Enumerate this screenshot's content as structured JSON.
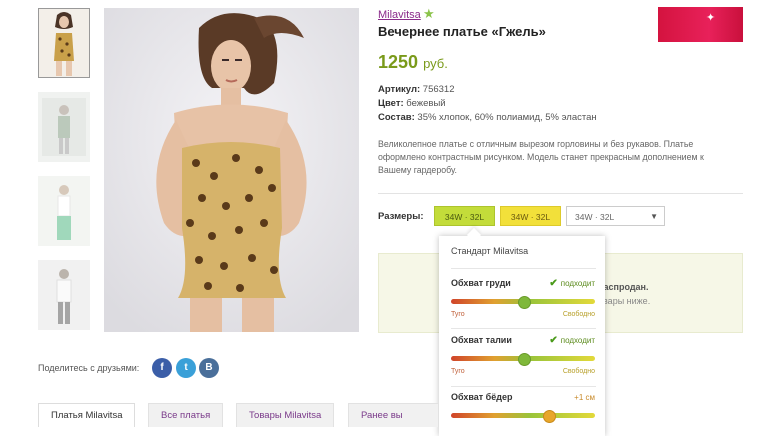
{
  "product": {
    "brand_link": "Milavitsa",
    "title": "Вечернее платье «Гжель»",
    "price_value": "1250",
    "price_currency": "руб.",
    "sku_label": "Артикул:",
    "sku_value": "756312",
    "color_label": "Цвет:",
    "color_value": "бежевый",
    "composition_label": "Состав:",
    "composition_value": "35% хлопок, 60% полиамид, 5% эластан",
    "description": "Великолепное платье с отличным вырезом горловины и без рукавов. Платье оформлено контрастным рисунком. Модель станет прекрасным дополнением к Вашему гардеробу."
  },
  "sizes": {
    "label": "Размеры:",
    "options": [
      "34W · 32L",
      "34W · 32L"
    ],
    "select_value": "34W · 32L"
  },
  "availability": {
    "line1": "распродан.",
    "line2": "овары ниже."
  },
  "fit_popup": {
    "title": "Стандарт Milavitsa",
    "measures": [
      {
        "name": "Обхват груди",
        "status": "подходит",
        "level": 0.5,
        "left": "Туго",
        "right": "Свободно",
        "check": "✔"
      },
      {
        "name": "Обхват талии",
        "status": "подходит",
        "level": 0.5,
        "left": "Туго",
        "right": "Свободно",
        "check": "✔"
      },
      {
        "name": "Обхват бёдер",
        "status": "+1 см",
        "level": 0.68
      }
    ]
  },
  "share": {
    "label": "Поделитесь с друзьями:",
    "facebook": "f",
    "twitter": "t",
    "vk": "B"
  },
  "tabs": [
    "Платья Milavitsa",
    "Все платья",
    "Товары Milavitsa",
    "Ранее вы смотр"
  ],
  "colors": {
    "brand_purple": "#8a2a8a",
    "price_green": "#7a9a1a",
    "size_green": "#c3dc3a",
    "size_yellow": "#f2e03a"
  }
}
